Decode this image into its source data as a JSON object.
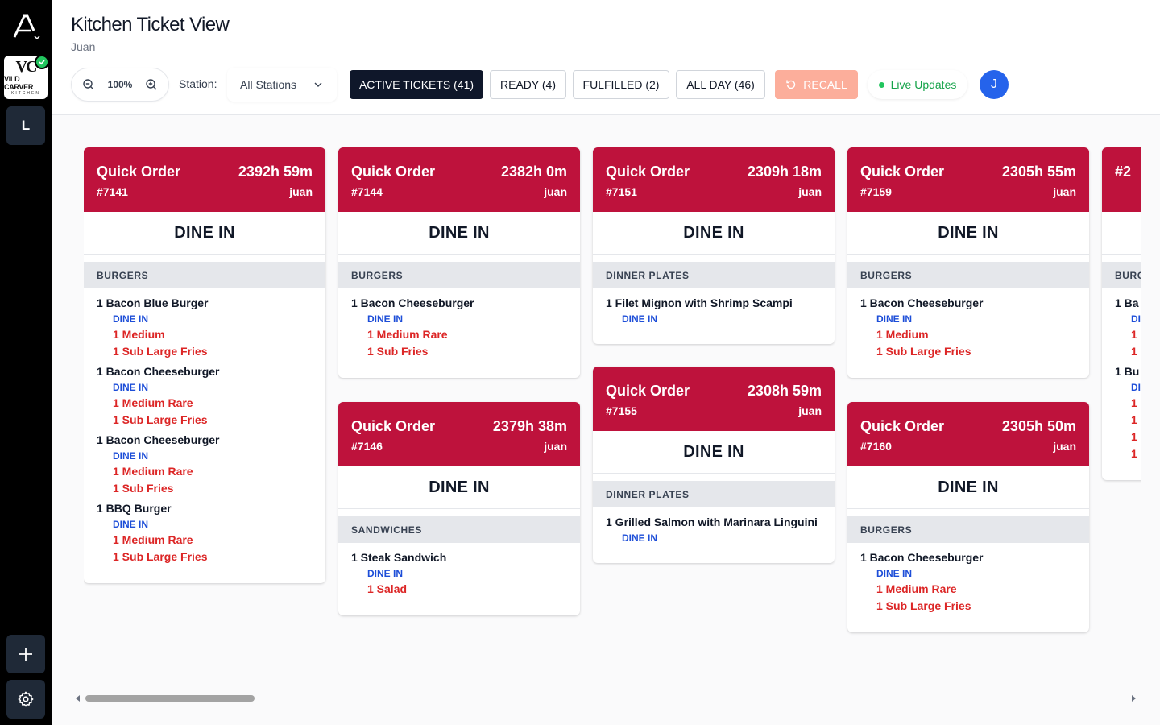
{
  "rail": {
    "brand_monogram": "VC",
    "brand_word": "VILD CARVER",
    "brand_sub": "KITCHEN",
    "location_letter": "L",
    "add_icon": "plus-icon",
    "settings_icon": "gear-icon"
  },
  "header": {
    "title": "Kitchen Ticket View",
    "subtitle": "Juan",
    "zoom": "100%",
    "station_label": "Station:",
    "station_value": "All Stations",
    "tabs": [
      {
        "label": "ACTIVE TICKETS (41)"
      },
      {
        "label": "READY (4)"
      },
      {
        "label": "FULFILLED (2)"
      },
      {
        "label": "ALL DAY (46)"
      }
    ],
    "recall": "RECALL",
    "live": "Live Updates",
    "avatar": "J"
  },
  "colors": {
    "ticket_header": "#be123c",
    "modifier": "#dc2626",
    "dine_in": "#1d4ed8",
    "active_tab": "#0f172a",
    "recall": "#fcae9b",
    "live": "#16a34a"
  },
  "tickets": [
    {
      "type": "Quick Order",
      "time": "2392h 59m",
      "number": "#7141",
      "user": "juan",
      "mode": "DINE IN",
      "category": "BURGERS",
      "items": [
        {
          "name": "1 Bacon Blue Burger",
          "mode": "DINE IN",
          "mods": [
            "1 Medium",
            "1 Sub Large Fries"
          ]
        },
        {
          "name": "1 Bacon Cheeseburger",
          "mode": "DINE IN",
          "mods": [
            "1 Medium Rare",
            "1 Sub Large Fries"
          ]
        },
        {
          "name": "1 Bacon Cheeseburger",
          "mode": "DINE IN",
          "mods": [
            "1 Medium Rare",
            "1 Sub Fries"
          ]
        },
        {
          "name": "1 BBQ Burger",
          "mode": "DINE IN",
          "mods": [
            "1 Medium Rare",
            "1 Sub Large Fries"
          ]
        }
      ]
    },
    {
      "type": "Quick Order",
      "time": "2382h 0m",
      "number": "#7144",
      "user": "juan",
      "mode": "DINE IN",
      "category": "BURGERS",
      "items": [
        {
          "name": "1 Bacon Cheeseburger",
          "mode": "DINE IN",
          "mods": [
            "1 Medium Rare",
            "1 Sub Fries"
          ]
        }
      ]
    },
    {
      "type": "Quick Order",
      "time": "2379h 38m",
      "number": "#7146",
      "user": "juan",
      "mode": "DINE IN",
      "category": "SANDWICHES",
      "items": [
        {
          "name": "1 Steak Sandwich",
          "mode": "DINE IN",
          "mods": [
            "1 Salad"
          ]
        }
      ]
    },
    {
      "type": "Quick Order",
      "time": "2309h 18m",
      "number": "#7151",
      "user": "juan",
      "mode": "DINE IN",
      "category": "DINNER PLATES",
      "items": [
        {
          "name": "1 Filet Mignon with Shrimp Scampi",
          "mode": "DINE IN",
          "mods": []
        }
      ]
    },
    {
      "type": "Quick Order",
      "time": "2308h 59m",
      "number": "#7155",
      "user": "juan",
      "mode": "DINE IN",
      "category": "DINNER PLATES",
      "items": [
        {
          "name": "1 Grilled Salmon with Marinara Linguini",
          "mode": "DINE IN",
          "mods": []
        }
      ]
    },
    {
      "type": "Quick Order",
      "time": "2305h 55m",
      "number": "#7159",
      "user": "juan",
      "mode": "DINE IN",
      "category": "BURGERS",
      "items": [
        {
          "name": "1 Bacon Cheeseburger",
          "mode": "DINE IN",
          "mods": [
            "1 Medium",
            "1 Sub Large Fries"
          ]
        }
      ]
    },
    {
      "type": "Quick Order",
      "time": "2305h 50m",
      "number": "#7160",
      "user": "juan",
      "mode": "DINE IN",
      "category": "BURGERS",
      "items": [
        {
          "name": "1 Bacon Cheeseburger",
          "mode": "DINE IN",
          "mods": [
            "1 Medium Rare",
            "1 Sub Large Fries"
          ]
        }
      ]
    },
    {
      "type": "#2",
      "time": "",
      "number": "",
      "user": "",
      "mode": "",
      "category": "BURG",
      "items": [
        {
          "name": "1 Ba",
          "mode": "DI",
          "mods": [
            "1",
            "1"
          ]
        },
        {
          "name": "1 Bu",
          "mode": "DI",
          "mods": [
            "1",
            "1",
            "1",
            "1"
          ]
        }
      ]
    }
  ]
}
